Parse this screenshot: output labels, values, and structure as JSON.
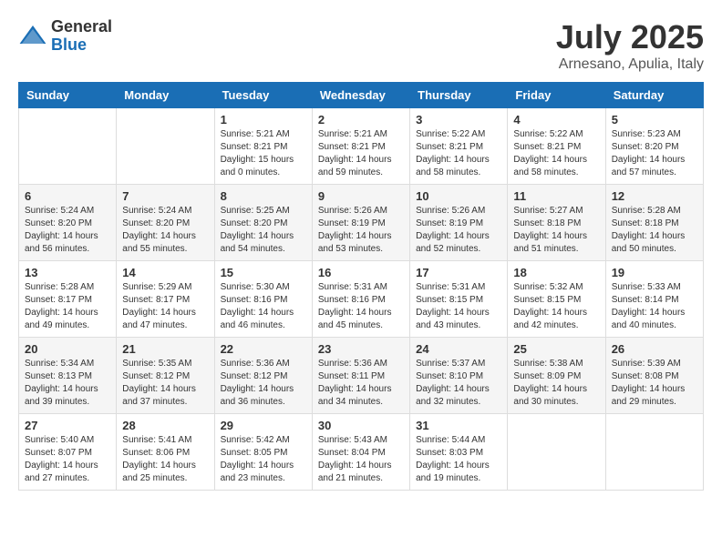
{
  "logo": {
    "general": "General",
    "blue": "Blue"
  },
  "title": {
    "month": "July 2025",
    "location": "Arnesano, Apulia, Italy"
  },
  "days_header": [
    "Sunday",
    "Monday",
    "Tuesday",
    "Wednesday",
    "Thursday",
    "Friday",
    "Saturday"
  ],
  "weeks": [
    [
      {
        "day": "",
        "info": ""
      },
      {
        "day": "",
        "info": ""
      },
      {
        "day": "1",
        "info": "Sunrise: 5:21 AM\nSunset: 8:21 PM\nDaylight: 15 hours\nand 0 minutes."
      },
      {
        "day": "2",
        "info": "Sunrise: 5:21 AM\nSunset: 8:21 PM\nDaylight: 14 hours\nand 59 minutes."
      },
      {
        "day": "3",
        "info": "Sunrise: 5:22 AM\nSunset: 8:21 PM\nDaylight: 14 hours\nand 58 minutes."
      },
      {
        "day": "4",
        "info": "Sunrise: 5:22 AM\nSunset: 8:21 PM\nDaylight: 14 hours\nand 58 minutes."
      },
      {
        "day": "5",
        "info": "Sunrise: 5:23 AM\nSunset: 8:20 PM\nDaylight: 14 hours\nand 57 minutes."
      }
    ],
    [
      {
        "day": "6",
        "info": "Sunrise: 5:24 AM\nSunset: 8:20 PM\nDaylight: 14 hours\nand 56 minutes."
      },
      {
        "day": "7",
        "info": "Sunrise: 5:24 AM\nSunset: 8:20 PM\nDaylight: 14 hours\nand 55 minutes."
      },
      {
        "day": "8",
        "info": "Sunrise: 5:25 AM\nSunset: 8:20 PM\nDaylight: 14 hours\nand 54 minutes."
      },
      {
        "day": "9",
        "info": "Sunrise: 5:26 AM\nSunset: 8:19 PM\nDaylight: 14 hours\nand 53 minutes."
      },
      {
        "day": "10",
        "info": "Sunrise: 5:26 AM\nSunset: 8:19 PM\nDaylight: 14 hours\nand 52 minutes."
      },
      {
        "day": "11",
        "info": "Sunrise: 5:27 AM\nSunset: 8:18 PM\nDaylight: 14 hours\nand 51 minutes."
      },
      {
        "day": "12",
        "info": "Sunrise: 5:28 AM\nSunset: 8:18 PM\nDaylight: 14 hours\nand 50 minutes."
      }
    ],
    [
      {
        "day": "13",
        "info": "Sunrise: 5:28 AM\nSunset: 8:17 PM\nDaylight: 14 hours\nand 49 minutes."
      },
      {
        "day": "14",
        "info": "Sunrise: 5:29 AM\nSunset: 8:17 PM\nDaylight: 14 hours\nand 47 minutes."
      },
      {
        "day": "15",
        "info": "Sunrise: 5:30 AM\nSunset: 8:16 PM\nDaylight: 14 hours\nand 46 minutes."
      },
      {
        "day": "16",
        "info": "Sunrise: 5:31 AM\nSunset: 8:16 PM\nDaylight: 14 hours\nand 45 minutes."
      },
      {
        "day": "17",
        "info": "Sunrise: 5:31 AM\nSunset: 8:15 PM\nDaylight: 14 hours\nand 43 minutes."
      },
      {
        "day": "18",
        "info": "Sunrise: 5:32 AM\nSunset: 8:15 PM\nDaylight: 14 hours\nand 42 minutes."
      },
      {
        "day": "19",
        "info": "Sunrise: 5:33 AM\nSunset: 8:14 PM\nDaylight: 14 hours\nand 40 minutes."
      }
    ],
    [
      {
        "day": "20",
        "info": "Sunrise: 5:34 AM\nSunset: 8:13 PM\nDaylight: 14 hours\nand 39 minutes."
      },
      {
        "day": "21",
        "info": "Sunrise: 5:35 AM\nSunset: 8:12 PM\nDaylight: 14 hours\nand 37 minutes."
      },
      {
        "day": "22",
        "info": "Sunrise: 5:36 AM\nSunset: 8:12 PM\nDaylight: 14 hours\nand 36 minutes."
      },
      {
        "day": "23",
        "info": "Sunrise: 5:36 AM\nSunset: 8:11 PM\nDaylight: 14 hours\nand 34 minutes."
      },
      {
        "day": "24",
        "info": "Sunrise: 5:37 AM\nSunset: 8:10 PM\nDaylight: 14 hours\nand 32 minutes."
      },
      {
        "day": "25",
        "info": "Sunrise: 5:38 AM\nSunset: 8:09 PM\nDaylight: 14 hours\nand 30 minutes."
      },
      {
        "day": "26",
        "info": "Sunrise: 5:39 AM\nSunset: 8:08 PM\nDaylight: 14 hours\nand 29 minutes."
      }
    ],
    [
      {
        "day": "27",
        "info": "Sunrise: 5:40 AM\nSunset: 8:07 PM\nDaylight: 14 hours\nand 27 minutes."
      },
      {
        "day": "28",
        "info": "Sunrise: 5:41 AM\nSunset: 8:06 PM\nDaylight: 14 hours\nand 25 minutes."
      },
      {
        "day": "29",
        "info": "Sunrise: 5:42 AM\nSunset: 8:05 PM\nDaylight: 14 hours\nand 23 minutes."
      },
      {
        "day": "30",
        "info": "Sunrise: 5:43 AM\nSunset: 8:04 PM\nDaylight: 14 hours\nand 21 minutes."
      },
      {
        "day": "31",
        "info": "Sunrise: 5:44 AM\nSunset: 8:03 PM\nDaylight: 14 hours\nand 19 minutes."
      },
      {
        "day": "",
        "info": ""
      },
      {
        "day": "",
        "info": ""
      }
    ]
  ]
}
